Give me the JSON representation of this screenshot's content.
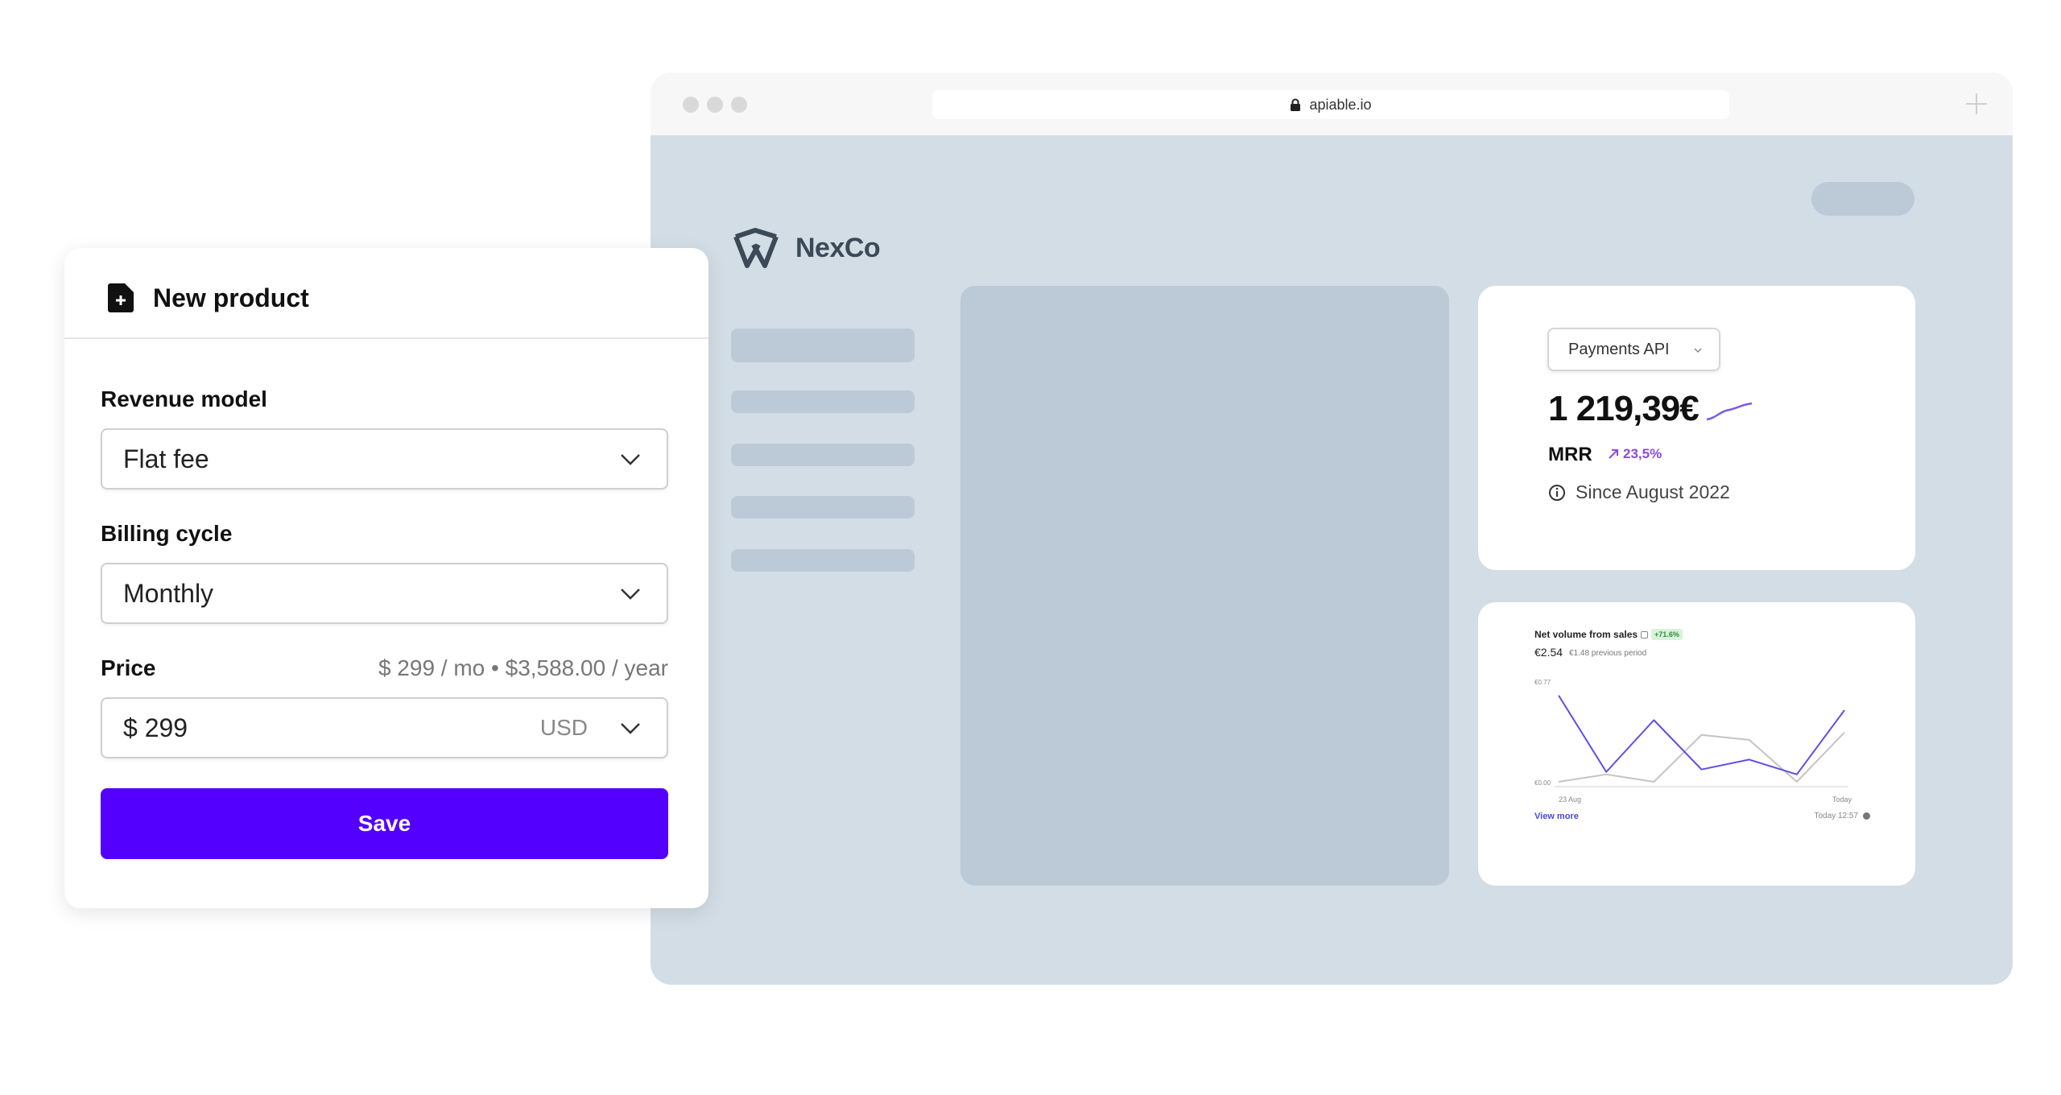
{
  "browser": {
    "url": "apiable.io"
  },
  "app": {
    "brand_name": "NexCo"
  },
  "mrr_card": {
    "api_select": "Payments API",
    "value": "1 219,39€",
    "label": "MRR",
    "growth": "23,5%",
    "since": "Since August 2022"
  },
  "chart_card": {
    "title": "Net volume from sales",
    "badge": "+71.6%",
    "main_value": "€2.54",
    "previous": "€1.48 previous period",
    "view_more": "View more",
    "updated": "Today 12:57",
    "chart_data": {
      "type": "line",
      "title": "Net volume from sales",
      "x": [
        "23 Aug",
        "",
        "",
        "",
        "",
        "",
        "Today"
      ],
      "ylim": [
        0,
        0.77
      ],
      "yticks": [
        "€0.77",
        "€0.00"
      ],
      "xticks": [
        "23 Aug",
        "Today"
      ],
      "grid": false,
      "series": [
        {
          "values": [
            0.7,
            0.08,
            0.5,
            0.1,
            0.18,
            0.06,
            0.58
          ],
          "color": "#5b4ee6"
        },
        {
          "values": [
            0.0,
            0.06,
            0.0,
            0.38,
            0.34,
            0.0,
            0.4
          ],
          "color": "#c4c4c4"
        }
      ],
      "colors": {
        "current": "#5b4ee6",
        "previous": "#c4c4c4"
      }
    }
  },
  "panel": {
    "title": "New product",
    "revenue_model": {
      "label": "Revenue model",
      "value": "Flat fee"
    },
    "billing_cycle": {
      "label": "Billing cycle",
      "value": "Monthly"
    },
    "price": {
      "label": "Price",
      "summary": "$ 299 / mo • $3,588.00 / year",
      "value": "$ 299",
      "currency": "USD"
    },
    "save_label": "Save"
  },
  "colors": {
    "accent": "#5300ff",
    "browser_bg": "#d3dde6",
    "skeleton": "#bccad8",
    "growth": "#8b4be0",
    "badge_green": "#2b8a3e"
  }
}
